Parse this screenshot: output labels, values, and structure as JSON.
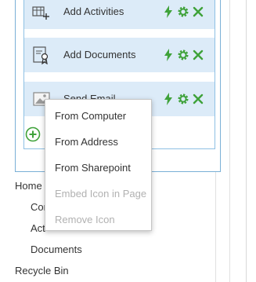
{
  "rows": [
    {
      "label": "Add Activities",
      "icon": "add-activities-icon"
    },
    {
      "label": "Add Documents",
      "icon": "add-documents-icon"
    },
    {
      "label": "Send Email",
      "icon": "image-icon"
    }
  ],
  "context_menu": {
    "items": [
      {
        "label": "From Computer",
        "enabled": true
      },
      {
        "label": "From Address",
        "enabled": true
      },
      {
        "label": "From Sharepoint",
        "enabled": true
      },
      {
        "label": "Embed Icon in Page",
        "enabled": false
      },
      {
        "label": "Remove Icon",
        "enabled": false
      }
    ]
  },
  "nav": {
    "home": "Home",
    "item_con": "Con",
    "item_act": "Act",
    "documents": "Documents",
    "recycle_bin": "Recycle Bin"
  },
  "colors": {
    "row_bg": "#dcebf8",
    "action_green": "#3fa23a",
    "panel_border": "#7ab0d6",
    "disabled_text": "#b1b1b1"
  }
}
